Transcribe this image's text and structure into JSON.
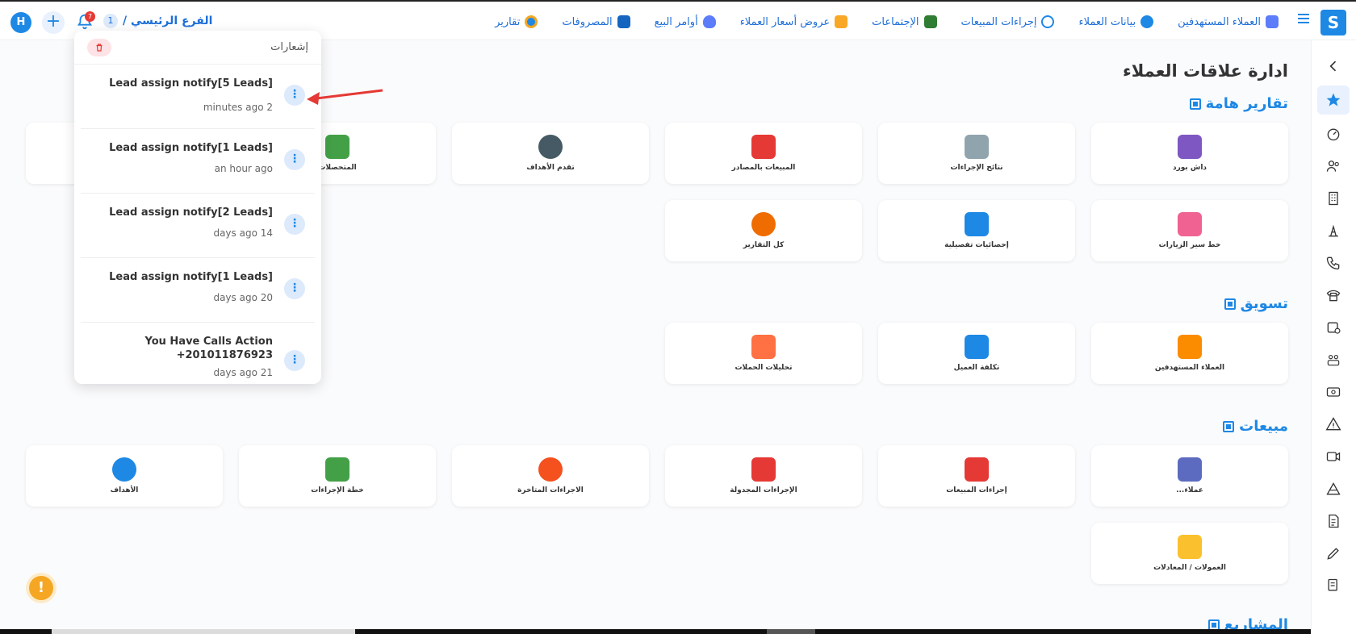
{
  "topbar": {
    "brand_letter": "S",
    "nav": [
      {
        "label": "العملاء المستهدفين",
        "icon": "target-clients-icon",
        "color": "#5c7cfa"
      },
      {
        "label": "بيانات العملاء",
        "icon": "customer-data-icon",
        "color": "#1e88e5"
      },
      {
        "label": "إجراءات المبيعات",
        "icon": "phone-icon",
        "color": "#1e88e5"
      },
      {
        "label": "الإجتماعات",
        "icon": "meetings-icon",
        "color": "#2e7d32"
      },
      {
        "label": "عروض أسعار العملاء",
        "icon": "quote-icon",
        "color": "#f9a825"
      },
      {
        "label": "أوامر البيع",
        "icon": "money-bag-icon",
        "color": "#5c7cfa"
      },
      {
        "label": "المصروفات",
        "icon": "expenses-icon",
        "color": "#1565c0"
      },
      {
        "label": "تقارير",
        "icon": "reports-icon",
        "color": "#f5a623"
      }
    ],
    "branch_label": "الفرع الرئيسي /",
    "branch_count": "1",
    "bell_badge": "7",
    "avatar_letter": "H",
    "plus_label": "+"
  },
  "notifications": {
    "title": "إشعارات",
    "items": [
      {
        "title": "Lead assign notify[5 Leads]",
        "time": "minutes ago 2"
      },
      {
        "title": "Lead assign notify[1 Leads]",
        "time": "an hour ago"
      },
      {
        "title": "Lead assign notify[2 Leads]",
        "time": "days ago 14"
      },
      {
        "title": "Lead assign notify[1 Leads]",
        "time": "days ago 20"
      },
      {
        "title": "You Have Calls Action +201011876923",
        "time": "days ago 21"
      }
    ],
    "dots": "⋮"
  },
  "main": {
    "title": "ادارة علاقات العملاء",
    "sections": {
      "important": "تقارير هامة",
      "marketing": "تسويق",
      "sales": "مبيعات",
      "projects": "المشاريع"
    },
    "important_cards": [
      {
        "label": "داش بورد",
        "color": "#7e57c2"
      },
      {
        "label": "نتائج الإجراءات",
        "color": "#90a4ae"
      },
      {
        "label": "المبيعات بالمصادر",
        "color": "#e53935"
      },
      {
        "label": "تقدم الأهداف",
        "color": "#455a64"
      },
      {
        "label": "المتحصلات",
        "color": "#43a047"
      },
      {
        "label": "خط سير الزيارات",
        "color": "#f06292"
      },
      {
        "label": "إحصائيات تفصيلية",
        "color": "#1e88e5"
      },
      {
        "label": "كل التقارير",
        "color": "#ef6c00"
      }
    ],
    "marketing_cards": [
      {
        "label": "العملاء المستهدفين",
        "color": "#fb8c00"
      },
      {
        "label": "تكلفة العميل",
        "color": "#1e88e5"
      },
      {
        "label": "تحليلات الحملات",
        "color": "#ff7043"
      }
    ],
    "sales_cards": [
      {
        "label": "عملاء...",
        "color": "#5c6bc0"
      },
      {
        "label": "إجراءات المبيعات",
        "color": "#e53935"
      },
      {
        "label": "الإجراءات المجدولة",
        "color": "#e53935"
      },
      {
        "label": "الاجراءات المتاخرة",
        "color": "#f4511e"
      },
      {
        "label": "خطة الإجراءات",
        "color": "#43a047"
      },
      {
        "label": "الأهداف",
        "color": "#1e88e5"
      },
      {
        "label": "العمولات / المعادلات",
        "color": "#fbc02d"
      }
    ]
  },
  "fab": {
    "label": "!"
  },
  "colors": {
    "accent": "#1e88e5",
    "danger": "#e53935",
    "warning": "#f5a623"
  }
}
